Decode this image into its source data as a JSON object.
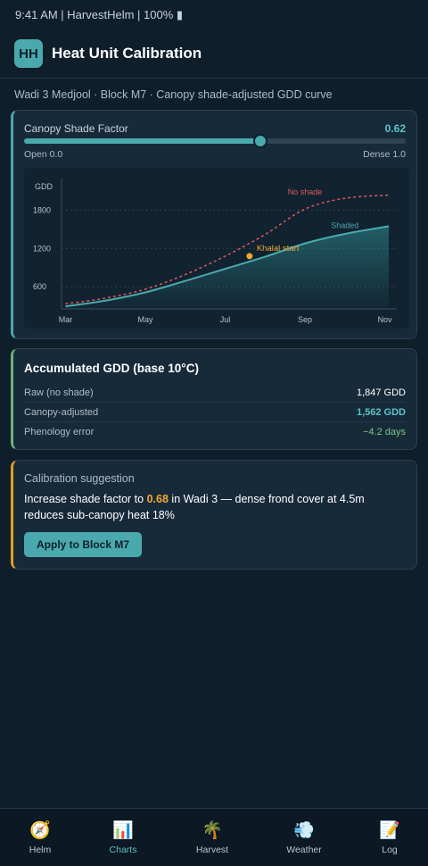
{
  "status_bar": {
    "text": "9:41 AM | HarvestHelm | 100% ▮"
  },
  "header": {
    "logo": "HH",
    "title": "Heat Unit Calibration"
  },
  "context": "Wadi 3 Medjool · Block M7 · Canopy shade-adjusted GDD curve",
  "shade": {
    "label": "Canopy Shade Factor",
    "value_text": "0.62",
    "value": 0.62,
    "min_label": "Open 0.0",
    "max_label": "Dense 1.0",
    "accent": "#4aa9ad"
  },
  "chart_data": {
    "type": "line",
    "ylabel": "GDD",
    "x_ticks": [
      "Mar",
      "May",
      "Jul",
      "Sep",
      "Nov"
    ],
    "x_tick_values": [
      0,
      2,
      4,
      6,
      8
    ],
    "y_ticks": [
      600,
      1200,
      1800
    ],
    "ylim": [
      250,
      2300
    ],
    "xlim": [
      -0.1,
      8.3
    ],
    "grid": true,
    "series": [
      {
        "name": "No shade",
        "style": "dashed",
        "color": "#e05a5a",
        "x": [
          0,
          1,
          2,
          3,
          4,
          5,
          6,
          7,
          8.1
        ],
        "values": [
          330,
          420,
          560,
          790,
          1080,
          1420,
          1820,
          1990,
          2040
        ]
      },
      {
        "name": "Shaded",
        "style": "solid-area",
        "color": "#4aa9ad",
        "x": [
          0,
          1,
          2,
          3,
          4,
          5,
          6,
          7,
          8.1
        ],
        "values": [
          290,
          380,
          510,
          690,
          880,
          1070,
          1280,
          1430,
          1550
        ]
      }
    ],
    "annotations": [
      {
        "label": "Khalal start",
        "x": 4.7,
        "y": 1080,
        "color": "#f0a830"
      }
    ]
  },
  "gdd": {
    "title": "Accumulated GDD (base 10°C)",
    "rows": [
      {
        "label": "Raw (no shade)",
        "value": "1,847 GDD"
      },
      {
        "label": "Canopy-adjusted",
        "value": "1,562 GDD"
      },
      {
        "label": "Phenology error",
        "value": "−4.2 days"
      }
    ]
  },
  "suggestion": {
    "title": "Calibration suggestion",
    "text_before": "Increase shade factor to ",
    "highlight": "0.68",
    "text_after": " in Wadi 3 — dense frond cover at 4.5m reduces sub-canopy heat 18%",
    "button_label": "Apply to Block M7"
  },
  "tabs": [
    {
      "icon": "🧭",
      "icon_name": "compass-icon",
      "label": "Helm"
    },
    {
      "icon": "📊",
      "icon_name": "bar-chart-icon",
      "label": "Charts",
      "active": true
    },
    {
      "icon": "🌴",
      "icon_name": "palm-tree-icon",
      "label": "Harvest"
    },
    {
      "icon": "💨",
      "icon_name": "wind-icon",
      "label": "Weather"
    },
    {
      "icon": "📝",
      "icon_name": "notepad-icon",
      "label": "Log"
    }
  ]
}
